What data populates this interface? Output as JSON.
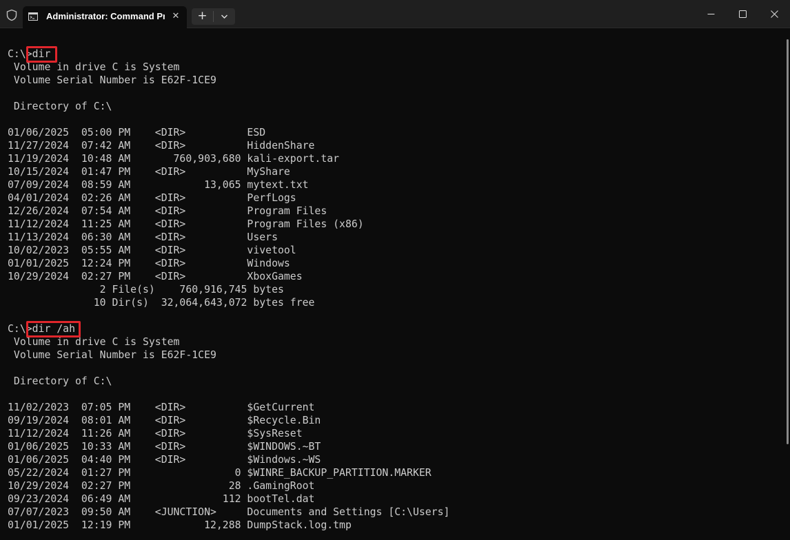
{
  "window": {
    "tab_title": "Administrator: Command Pro",
    "new_tab_symbol": "+",
    "close_tab_symbol": "✕"
  },
  "icons": {
    "shield": "shield-icon",
    "tab": "cmd-icon",
    "dropdown": "chevron-down-icon",
    "minimize": "minimize-icon",
    "maximize": "maximize-icon",
    "close": "close-icon"
  },
  "colors": {
    "background": "#0c0c0c",
    "titlebar": "#1f1f1f",
    "text": "#cccccc",
    "highlight_box": "#e0262c"
  },
  "terminal": {
    "lines": [
      "C:\\>dir",
      " Volume in drive C is System",
      " Volume Serial Number is E62F-1CE9",
      "",
      " Directory of C:\\",
      "",
      "01/06/2025  05:00 PM    <DIR>          ESD",
      "11/27/2024  07:42 AM    <DIR>          HiddenShare",
      "11/19/2024  10:48 AM       760,903,680 kali-export.tar",
      "10/15/2024  01:47 PM    <DIR>          MyShare",
      "07/09/2024  08:59 AM            13,065 mytext.txt",
      "04/01/2024  02:26 AM    <DIR>          PerfLogs",
      "12/26/2024  07:54 AM    <DIR>          Program Files",
      "11/12/2024  11:25 AM    <DIR>          Program Files (x86)",
      "11/13/2024  06:30 AM    <DIR>          Users",
      "10/02/2023  05:55 AM    <DIR>          vivetool",
      "01/01/2025  12:24 PM    <DIR>          Windows",
      "10/29/2024  02:27 PM    <DIR>          XboxGames",
      "               2 File(s)    760,916,745 bytes",
      "              10 Dir(s)  32,064,643,072 bytes free",
      "",
      "C:\\>dir /ah",
      " Volume in drive C is System",
      " Volume Serial Number is E62F-1CE9",
      "",
      " Directory of C:\\",
      "",
      "11/02/2023  07:05 PM    <DIR>          $GetCurrent",
      "09/19/2024  08:01 AM    <DIR>          $Recycle.Bin",
      "11/12/2024  11:26 AM    <DIR>          $SysReset",
      "01/06/2025  10:33 AM    <DIR>          $WINDOWS.~BT",
      "01/06/2025  04:40 PM    <DIR>          $Windows.~WS",
      "05/22/2024  01:27 PM                 0 $WINRE_BACKUP_PARTITION.MARKER",
      "10/29/2024  02:27 PM                28 .GamingRoot",
      "09/23/2024  06:49 AM               112 bootTel.dat",
      "07/07/2023  09:50 AM    <JUNCTION>     Documents and Settings [C:\\Users]",
      "01/01/2025  12:19 PM            12,288 DumpStack.log.tmp"
    ]
  }
}
